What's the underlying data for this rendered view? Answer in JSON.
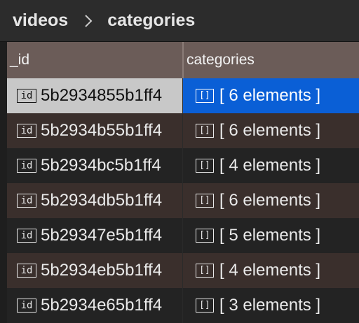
{
  "breadcrumb": {
    "items": [
      "videos",
      "categories"
    ]
  },
  "table": {
    "columns": [
      "_id",
      "categories"
    ],
    "rows": [
      {
        "id": "5b2934855b1ff4",
        "categories": "[ 6 elements ]"
      },
      {
        "id": "5b2934b55b1ff4",
        "categories": "[ 6 elements ]"
      },
      {
        "id": "5b2934bc5b1ff4",
        "categories": "[ 4 elements ]"
      },
      {
        "id": "5b2934db5b1ff4",
        "categories": "[ 6 elements ]"
      },
      {
        "id": "5b29347e5b1ff4",
        "categories": "[ 5 elements ]"
      },
      {
        "id": "5b2934eb5b1ff4",
        "categories": "[ 4 elements ]"
      },
      {
        "id": "5b2934e65b1ff4",
        "categories": "[ 3 elements ]"
      }
    ],
    "selected_row": 0
  },
  "icons": {
    "id_badge": "id",
    "array_badge": "[]"
  },
  "colors": {
    "header_bg": "#6b5c58",
    "selection_blue": "#0a5fd6",
    "row_alt": "#3a2f2c",
    "row_base": "#232323"
  }
}
